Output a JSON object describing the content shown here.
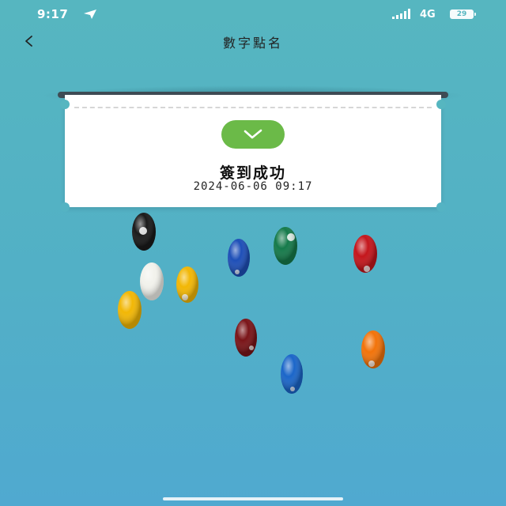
{
  "status_bar": {
    "time": "9:17",
    "network": "4G",
    "battery": "29"
  },
  "nav": {
    "back_label": "<",
    "title": "數字點名"
  },
  "ticket": {
    "status": "簽到成功",
    "timestamp": "2024-06-06 09:17"
  },
  "icons": {
    "location": "location-arrow-icon",
    "signal": "signal-bars-icon",
    "battery": "battery-icon",
    "back": "chevron-left-icon",
    "success": "checkmark-icon"
  },
  "colors": {
    "background": "#56b6c0",
    "success_green": "#6bba48",
    "rail": "#3f4c55"
  }
}
